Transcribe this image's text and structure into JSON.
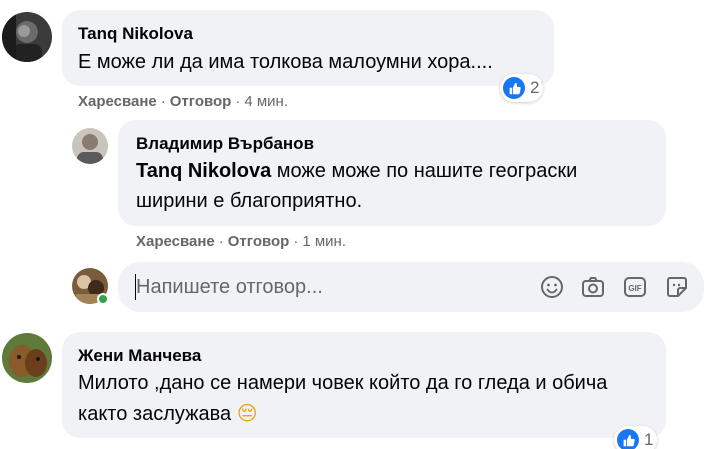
{
  "comments": [
    {
      "author": "Tanq Nikolova",
      "text": "Е може ли да има толкова малоумни хора....",
      "like_label": "Харесване",
      "reply_label": "Отговор",
      "time": "4 мин.",
      "reaction_count": "2",
      "reaction_icon": "like-icon"
    },
    {
      "author": "Жени Манчева",
      "text": "Милото ,дано се намери човек който да го гледа и обича както заслужава",
      "emoji": "😔",
      "reaction_count": "1",
      "reaction_icon": "like-icon"
    }
  ],
  "replies": [
    {
      "author": "Владимир Върбанов",
      "mention": "Tanq Nikolova",
      "line1": " може може по нашите геограски",
      "line2": "ширини е благоприятно.",
      "like_label": "Харесване",
      "reply_label": "Отговор",
      "time": "1 мин."
    }
  ],
  "reply_composer": {
    "placeholder": "Напишете отговор...",
    "tools": [
      "emoji-icon",
      "camera-icon",
      "gif-icon",
      "sticker-icon"
    ]
  },
  "colors": {
    "bubble": "#f0f2f5",
    "secondary_text": "#65676b",
    "like_blue": "#1877f2",
    "online_green": "#31a24c"
  },
  "separator": "·"
}
